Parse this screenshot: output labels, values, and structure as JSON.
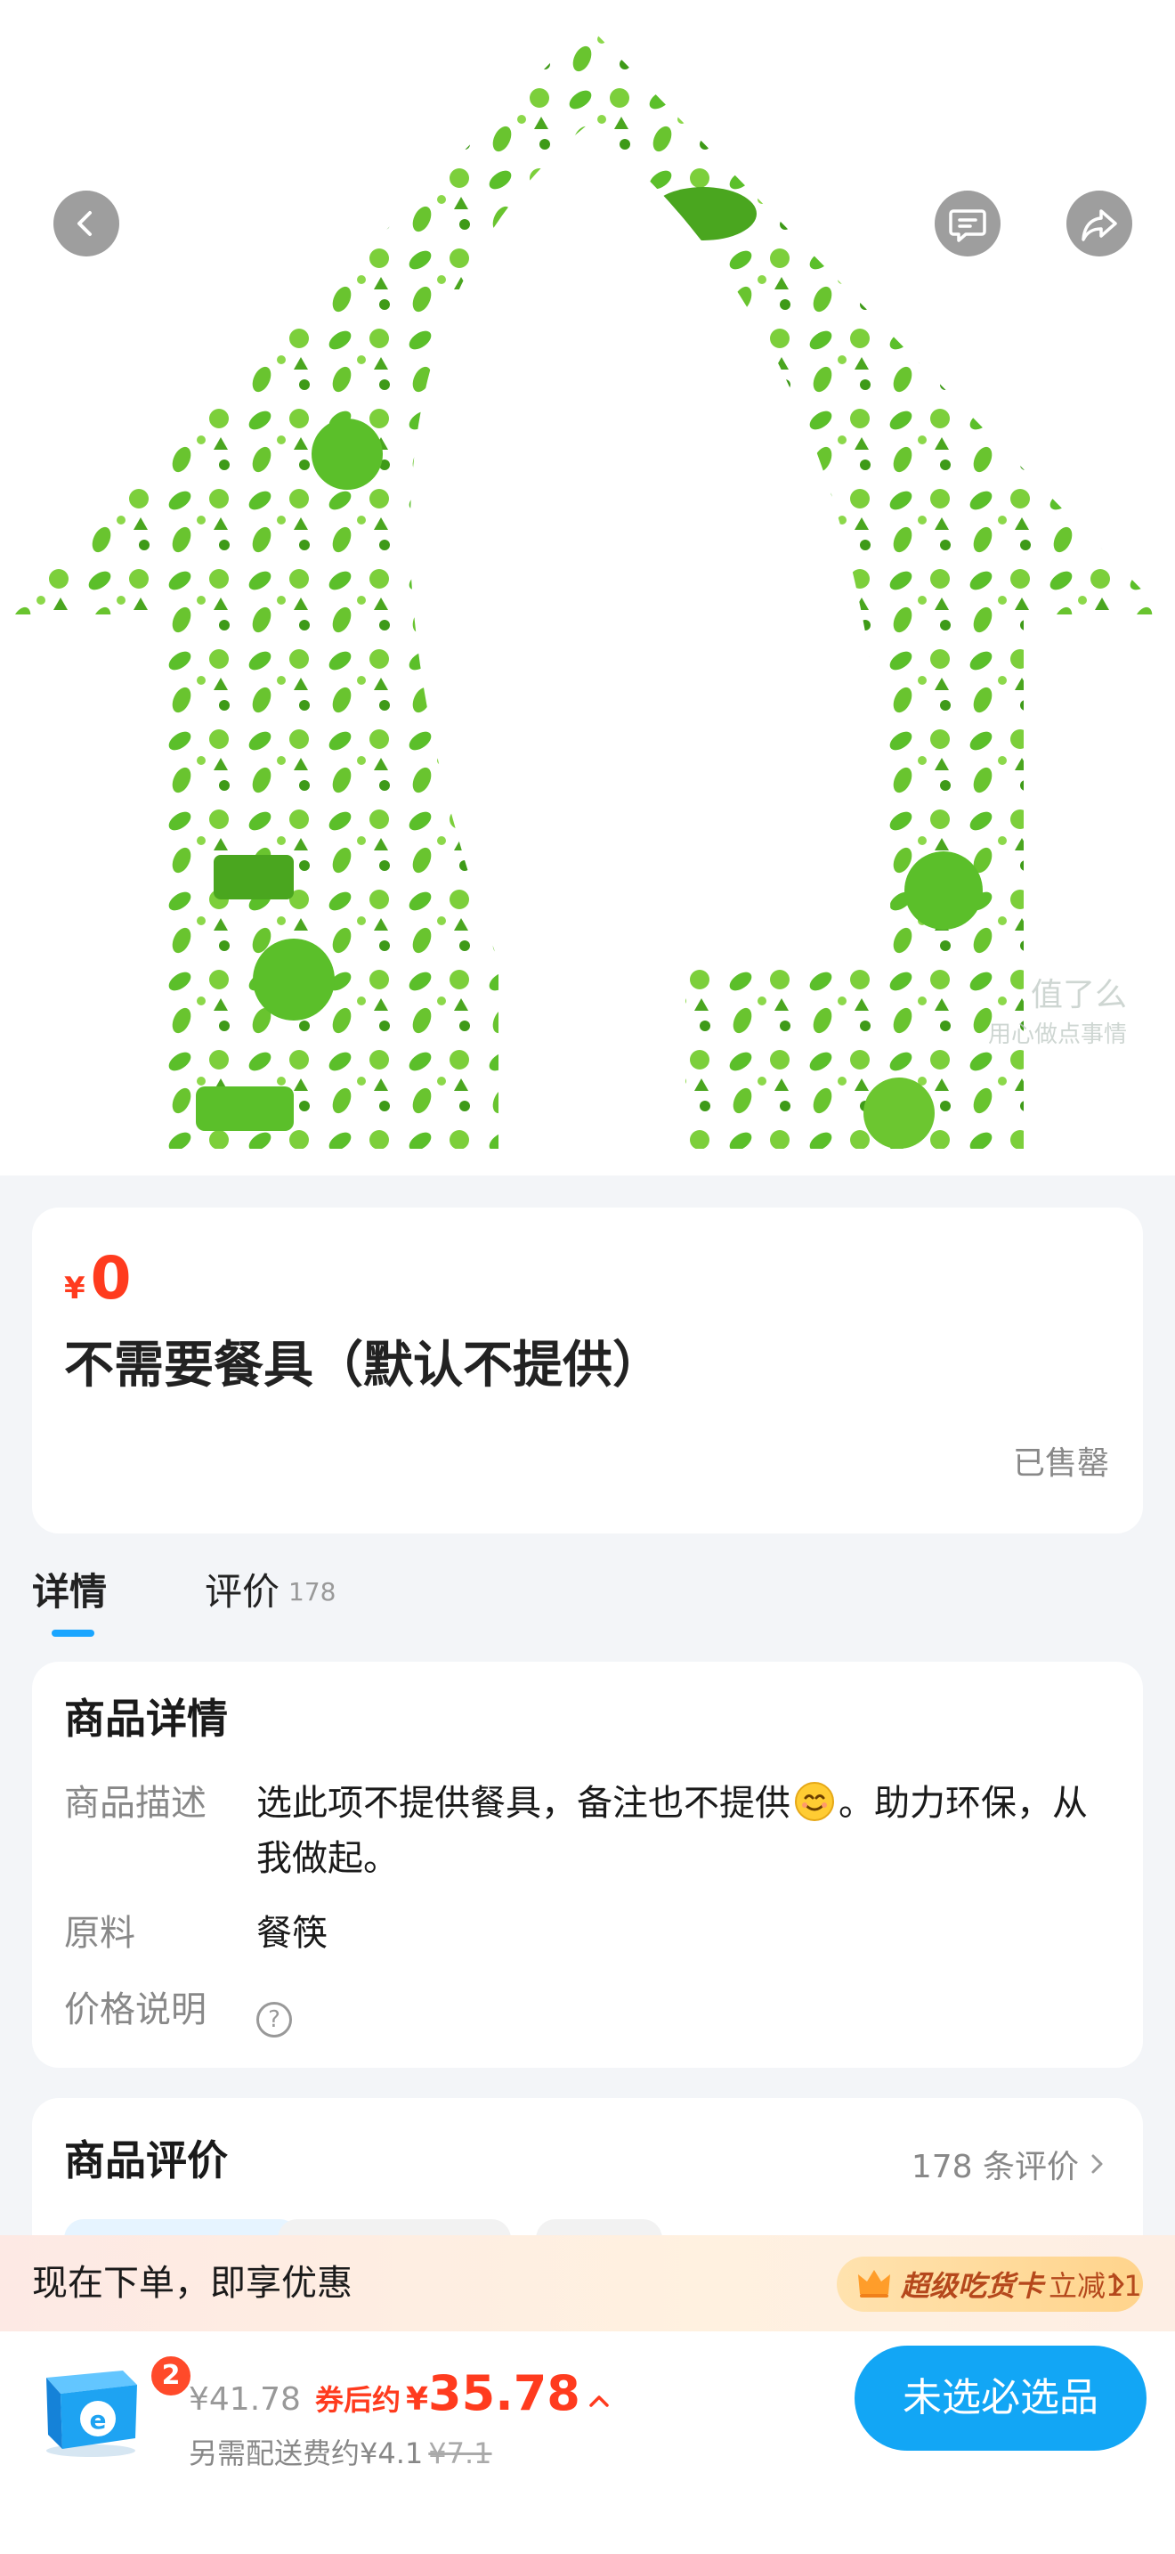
{
  "nav": {
    "back_icon": "chevron-left-icon",
    "chat_icon": "chat-bubble-icon",
    "share_icon": "share-arrow-icon"
  },
  "hero": {
    "image": "green eco house made of environmental icons",
    "watermark_line1": "值了么",
    "watermark_line2": "用心做点事情"
  },
  "product": {
    "currency": "¥",
    "price": "0",
    "name": "不需要餐具（默认不提供）",
    "status": "已售罄"
  },
  "tabs": [
    {
      "label": "详情",
      "count": "",
      "active": true
    },
    {
      "label": "评价",
      "count": "178",
      "active": false
    }
  ],
  "details": {
    "title": "商品详情",
    "rows": [
      {
        "label": "商品描述",
        "value_part1": "选此项不提供餐具，备注也不提供",
        "value_part2": "。助力环保，从我做起。"
      },
      {
        "label": "原料",
        "value": "餐筷"
      },
      {
        "label": "价格说明",
        "help": "?"
      }
    ]
  },
  "reviews": {
    "title": "商品评价",
    "more": "178 条评价"
  },
  "promo": {
    "text": "现在下单，即享优惠",
    "vip_brand": "超级吃货卡",
    "vip_offer": "立减11"
  },
  "bottom": {
    "cart_count": "2",
    "original_price": "¥41.78",
    "coupon_label": "券后约",
    "final_currency": "¥",
    "final_price": "35.78",
    "fee_text": "另需配送费约¥4.1",
    "fee_original": "¥7.1",
    "cta": "未选必选品"
  },
  "colors": {
    "accent_blue": "#12a6f5",
    "price_red": "#ff3b1e",
    "eco_green": "#5bbf2a"
  }
}
